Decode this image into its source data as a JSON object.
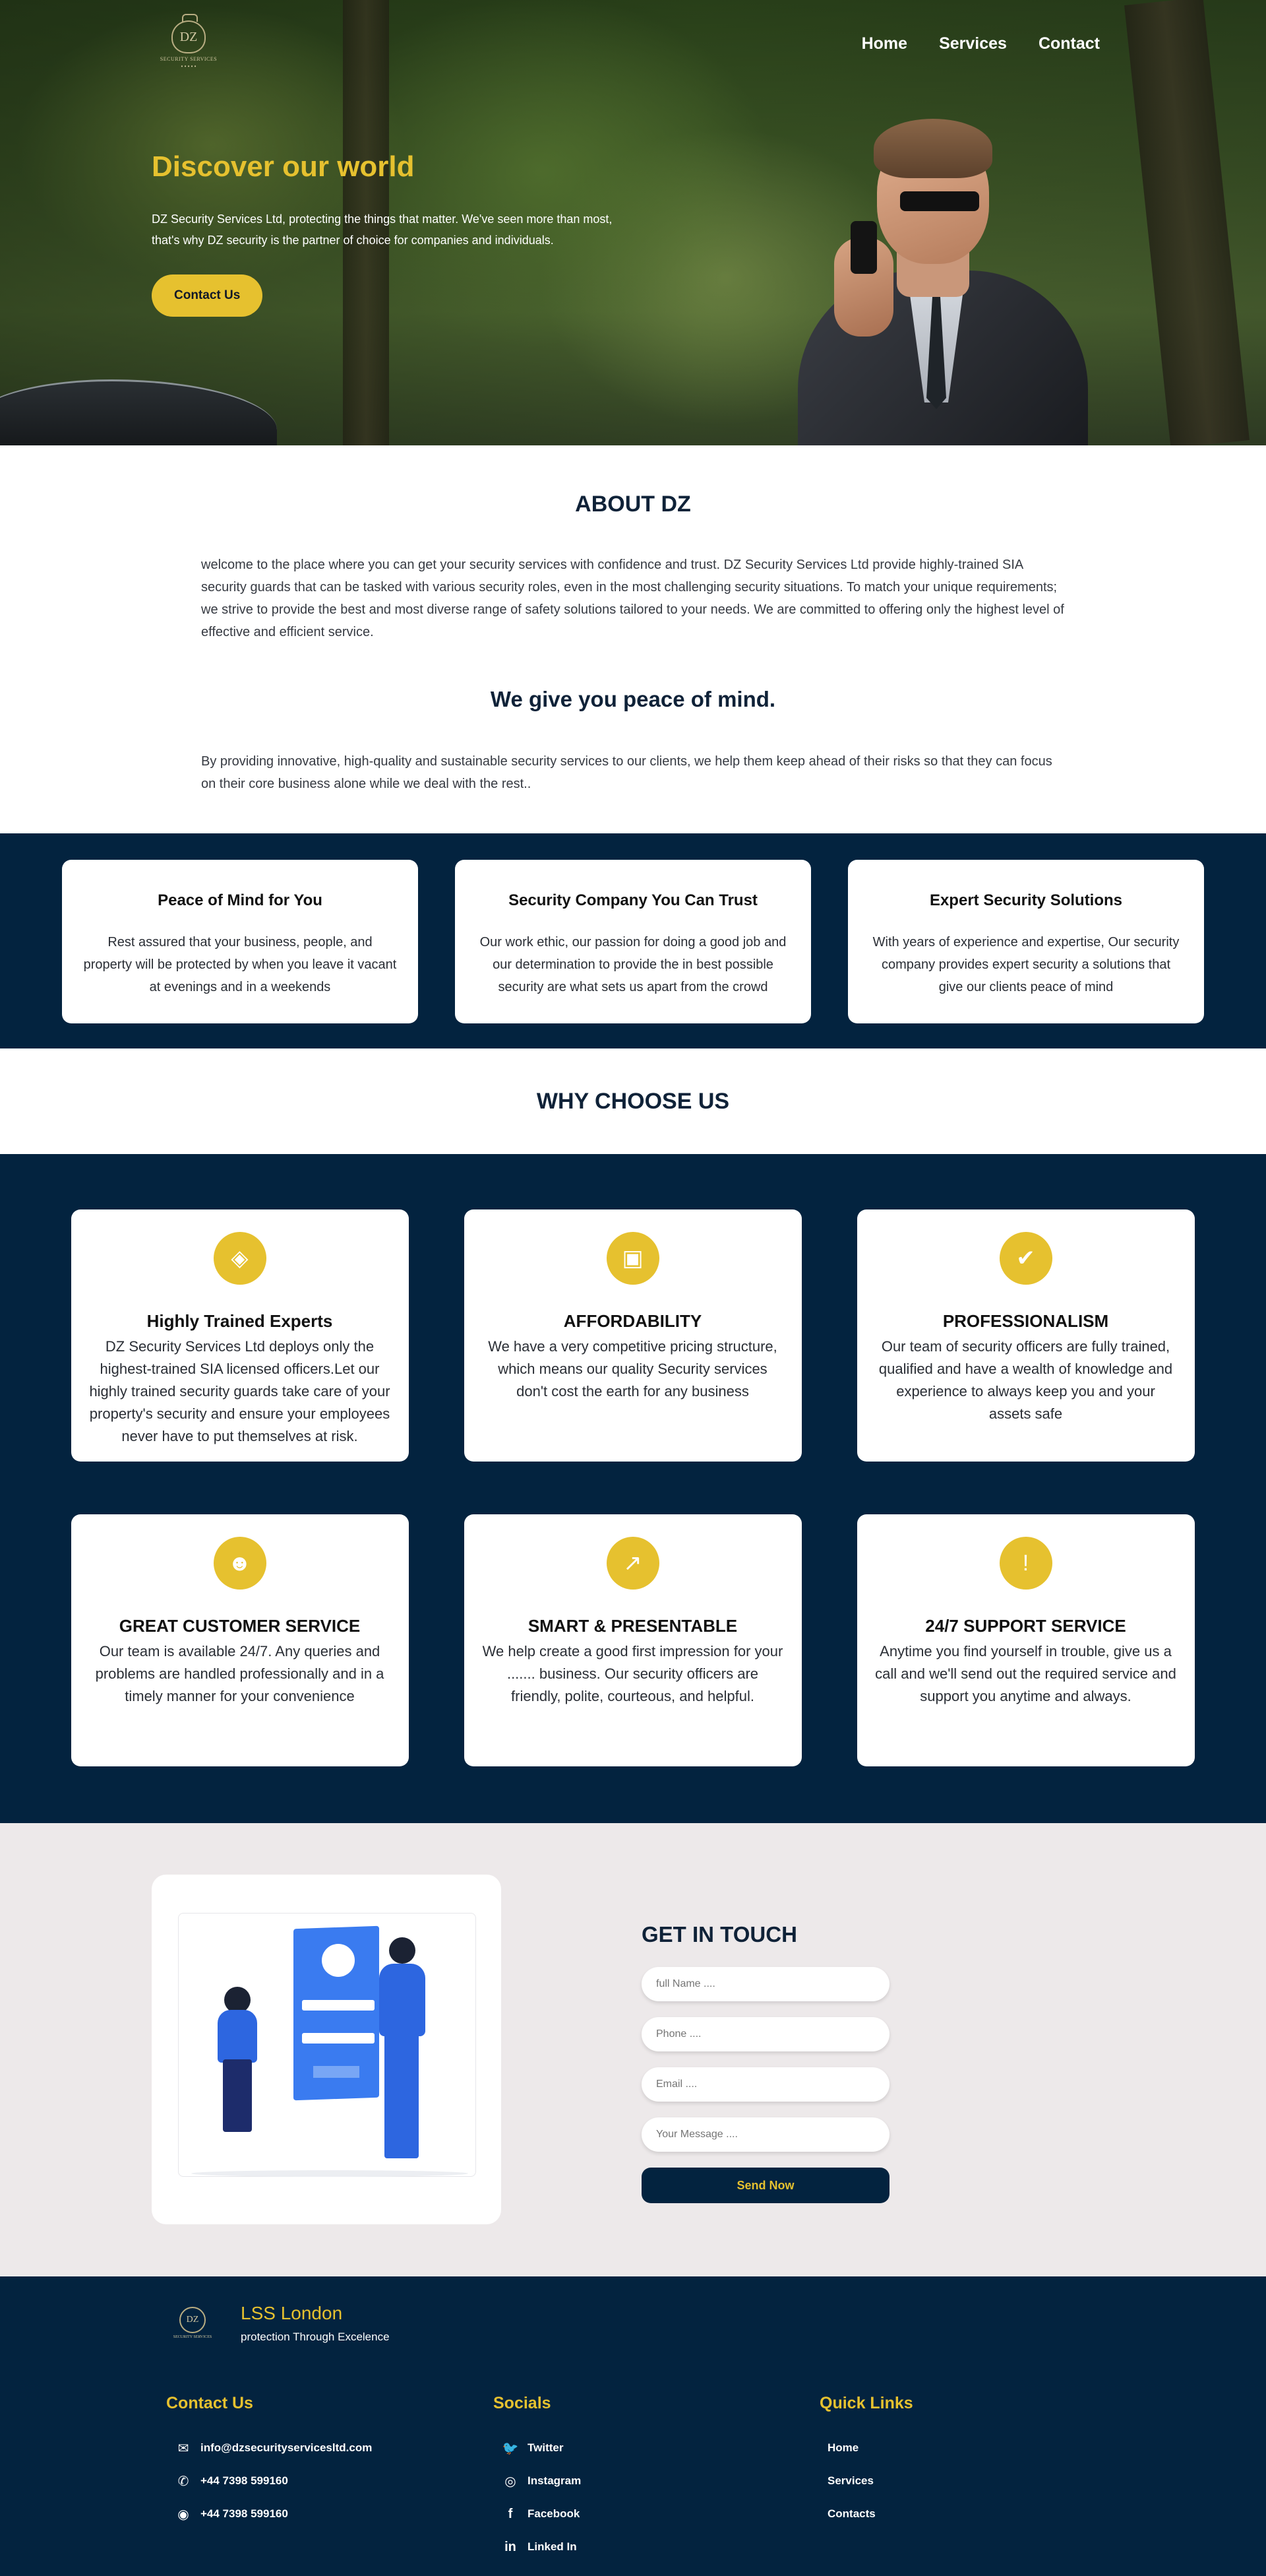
{
  "colors": {
    "accent": "#e6c12f",
    "navy": "#03233f",
    "contact_bg": "#ede9ea"
  },
  "logo": {
    "monogram": "DZ",
    "text": "SECURITY SERVICES",
    "dots": "• • • • •"
  },
  "nav": {
    "items": [
      {
        "label": "Home"
      },
      {
        "label": "Services"
      },
      {
        "label": "Contact"
      }
    ]
  },
  "hero": {
    "title": "Discover our world",
    "text": "DZ Security Services Ltd, protecting the things that matter. We've seen more than most, that's why DZ security is the partner of choice for companies and individuals.",
    "button": "Contact Us"
  },
  "about": {
    "title": "ABOUT DZ",
    "text": "welcome to the place where you can get your security services with confidence and trust. DZ Security Services Ltd provide highly-trained SIA security guards that can be tasked with various security roles, even in the most challenging security situations. To match your unique requirements; we strive to provide the best and most diverse range of safety solutions tailored to your needs. We are committed to offering only the highest level of effective and efficient service.",
    "subtitle": "We give you peace of mind.",
    "text2": "By providing innovative, high-quality and sustainable security services to our clients, we help them keep ahead of their risks so that they can focus on their core business alone while we deal with the rest.."
  },
  "features": [
    {
      "title": "Peace of Mind for You",
      "text": "Rest assured that your business, people, and property will be protected by when you leave it vacant at evenings and in a weekends"
    },
    {
      "title": "Security Company You Can Trust",
      "text": "Our work ethic, our passion for doing a good job and our determination to provide the in best possible security are what sets us apart from the crowd"
    },
    {
      "title": "Expert Security Solutions",
      "text": "With years of experience and expertise, Our security company provides expert security a solutions that give our clients peace of mind"
    }
  ],
  "why": {
    "title": "WHY CHOOSE US",
    "cards": [
      {
        "icon": "shield-icon",
        "glyph": "◈",
        "title": "Highly Trained Experts",
        "text": "DZ Security Services Ltd deploys only the highest-trained SIA licensed officers.Let our highly trained security guards take care of your property's security and ensure your employees never have to put themselves at risk."
      },
      {
        "icon": "money-icon",
        "glyph": "▣",
        "title": "AFFORDABILITY",
        "text": "We have a very competitive pricing structure, which means our quality Security services don't cost the earth for any business"
      },
      {
        "icon": "badge-check-icon",
        "glyph": "✔",
        "title": "PROFESSIONALISM",
        "text": "Our team of security officers are fully trained, qualified and have a wealth of knowledge and experience to always keep you and your assets safe"
      },
      {
        "icon": "people-icon",
        "glyph": "☻",
        "title": "GREAT CUSTOMER SERVICE",
        "text": "Our team is available 24/7. Any queries and problems are handled professionally and in a timely manner for your convenience"
      },
      {
        "icon": "trending-up-icon",
        "glyph": "↗",
        "title": "SMART & PRESENTABLE",
        "text": "We help create a good first impression for your ....... business. Our security officers are friendly, polite, courteous, and helpful."
      },
      {
        "icon": "alert-icon",
        "glyph": "!",
        "title": "24/7 SUPPORT SERVICE",
        "text": "Anytime you find yourself in trouble, give us a call and we'll send out the required service and support you anytime and always."
      }
    ]
  },
  "contact": {
    "title": "GET IN TOUCH",
    "placeholders": {
      "name": "full Name ....",
      "phone": "Phone ....",
      "email": "Email ....",
      "message": "Your Message ...."
    },
    "button": "Send Now"
  },
  "footer": {
    "brand": "LSS London",
    "tagline": "protection Through Excelence",
    "contact": {
      "title": "Contact Us",
      "items": [
        {
          "icon": "mail-icon",
          "glyph": "✉",
          "label": "info@dzsecurityservicesltd.com"
        },
        {
          "icon": "phone-icon",
          "glyph": "✆",
          "label": "+44 7398 599160"
        },
        {
          "icon": "whatsapp-icon",
          "glyph": "◉",
          "label": "+44 7398 599160"
        }
      ]
    },
    "socials": {
      "title": "Socials",
      "items": [
        {
          "icon": "twitter-icon",
          "glyph": "🐦",
          "label": "Twitter"
        },
        {
          "icon": "instagram-icon",
          "glyph": "◎",
          "label": "Instagram"
        },
        {
          "icon": "facebook-icon",
          "glyph": "f",
          "label": "Facebook"
        },
        {
          "icon": "linkedin-icon",
          "glyph": "in",
          "label": "Linked In"
        }
      ]
    },
    "links": {
      "title": "Quick Links",
      "items": [
        {
          "label": "Home"
        },
        {
          "label": "Services"
        },
        {
          "label": "Contacts"
        }
      ]
    }
  }
}
